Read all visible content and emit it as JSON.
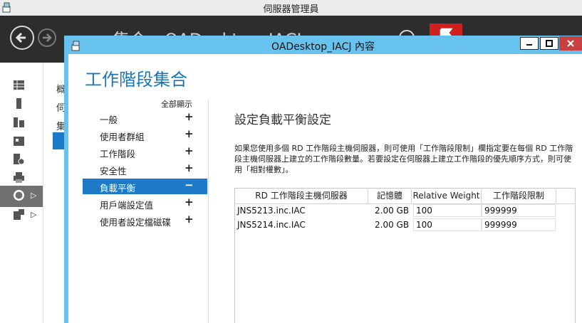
{
  "server_manager": {
    "title": "伺服器管理員",
    "header_text": "集合 › OADesktop_IACJ",
    "subnav": [
      "概",
      "伺",
      "集"
    ]
  },
  "dialog": {
    "title": "OADesktop_IACJ 內容",
    "heading": "工作階段集合",
    "show_all": "全部顯示",
    "nav": [
      {
        "label": "一般",
        "sym": "+"
      },
      {
        "label": "使用者群組",
        "sym": "+"
      },
      {
        "label": "工作階段",
        "sym": "+"
      },
      {
        "label": "安全性",
        "sym": "+"
      },
      {
        "label": "負載平衡",
        "sym": "−"
      },
      {
        "label": "用戶端設定值",
        "sym": "+"
      },
      {
        "label": "使用者設定檔磁碟",
        "sym": "+"
      }
    ],
    "section_title": "設定負載平衡設定",
    "section_desc": "如果您使用多個 RD 工作階段主機伺服器，則可使用「工作階段限制」欄指定要在每個 RD 工作階段主機伺服器上建立的工作階段數量。若要設定在伺服器上建立工作階段的優先順序方式，則可使用「相對權數」。",
    "table": {
      "headers": [
        "RD 工作階段主機伺服器",
        "記憶體",
        "Relative Weight",
        "工作階段限制"
      ],
      "rows": [
        {
          "server": "JNS5213.inc.IAC",
          "memory": "2.00 GB",
          "weight": "100",
          "limit": "999999"
        },
        {
          "server": "JNS5214.inc.IAC",
          "memory": "2.00 GB",
          "weight": "100",
          "limit": "999999"
        }
      ]
    }
  }
}
